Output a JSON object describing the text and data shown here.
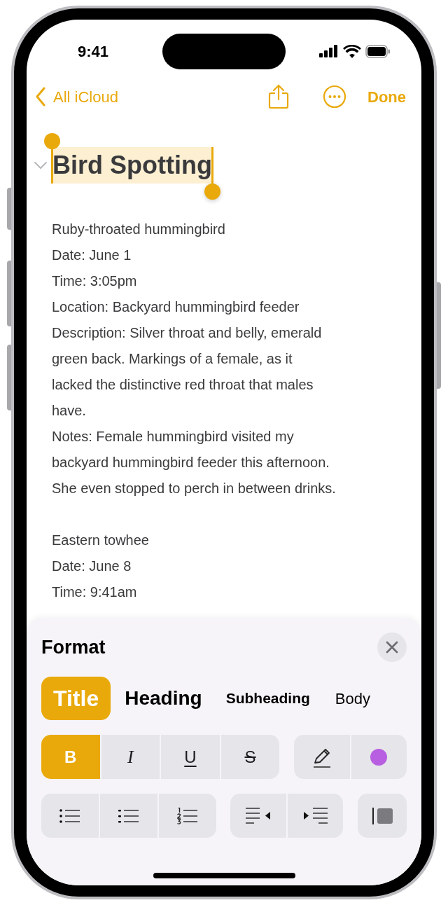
{
  "status_bar": {
    "time": "9:41"
  },
  "nav": {
    "back": "All iCloud",
    "done": "Done"
  },
  "note": {
    "title": "Bird Spotting",
    "title_selected": true,
    "paragraphs": [
      [
        "Ruby-throated hummingbird",
        "Date: June 1",
        "Time: 3:05pm",
        "Location: Backyard hummingbird feeder",
        "Description: Silver throat and belly, emerald",
        "green back. Markings of a female, as it",
        "lacked the distinctive red throat that males",
        "have.",
        "Notes: Female hummingbird visited my",
        "backyard hummingbird feeder this afternoon.",
        "She even stopped to perch in between drinks."
      ],
      [
        "Eastern towhee",
        "Date: June 8",
        "Time: 9:41am"
      ]
    ]
  },
  "format_panel": {
    "title": "Format",
    "styles": [
      {
        "kind": "title",
        "label": "Title",
        "selected": true
      },
      {
        "kind": "heading",
        "label": "Heading",
        "selected": false
      },
      {
        "kind": "subheading",
        "label": "Subheading",
        "selected": false
      },
      {
        "kind": "body",
        "label": "Body",
        "selected": false
      }
    ],
    "text_styles": [
      {
        "kind": "bold",
        "label": "B",
        "selected": true
      },
      {
        "kind": "italic",
        "label": "I",
        "selected": false
      },
      {
        "kind": "underline",
        "label": "U",
        "selected": false
      },
      {
        "kind": "strikethrough",
        "label": "S",
        "selected": false
      }
    ]
  }
}
